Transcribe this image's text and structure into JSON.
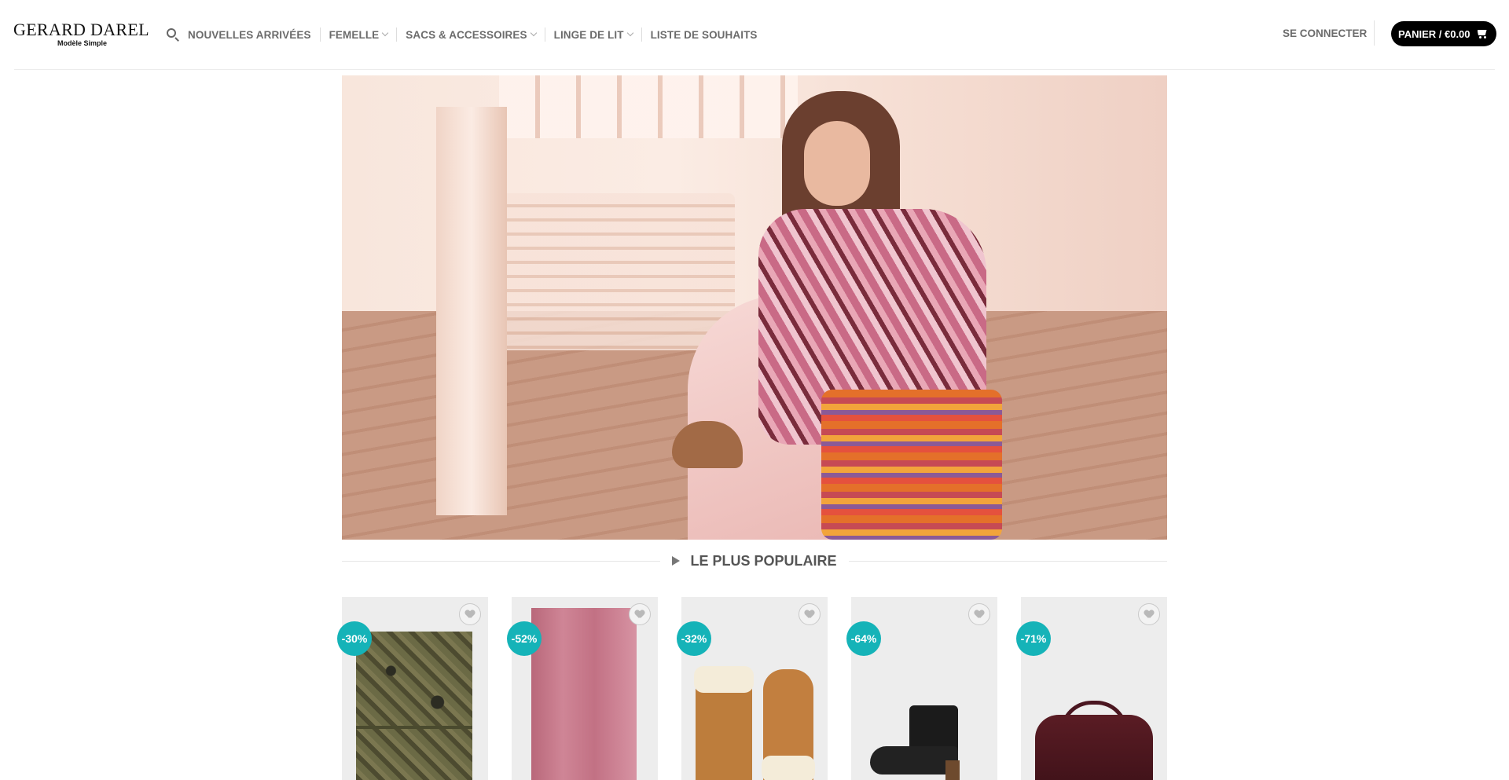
{
  "header": {
    "logo": {
      "main": "GERARD DAREL",
      "tagline": "Modèle Simple"
    },
    "nav": [
      {
        "label": "NOUVELLES ARRIVÉES",
        "dropdown": false
      },
      {
        "label": "FEMELLE",
        "dropdown": true
      },
      {
        "label": "SACS & ACCESSOIRES",
        "dropdown": true
      },
      {
        "label": "LINGE DE LIT",
        "dropdown": true
      },
      {
        "label": "LISTE DE SOUHAITS",
        "dropdown": false
      }
    ],
    "search_icon": "search-icon",
    "login_label": "SE CONNECTER",
    "cart_label": "PANIER / €0.00",
    "cart_icon": "cart-icon"
  },
  "section": {
    "title": "LE PLUS POPULAIRE"
  },
  "products": [
    {
      "badge": "-30%",
      "type": "scarf"
    },
    {
      "badge": "-52%",
      "type": "scarf"
    },
    {
      "badge": "-32%",
      "type": "gloves"
    },
    {
      "badge": "-64%",
      "type": "ankle boot"
    },
    {
      "badge": "-71%",
      "type": "handbag"
    }
  ],
  "colors": {
    "badge": "#15b3b8",
    "cart_button": "#000000",
    "nav_text": "#6b6b6b"
  }
}
